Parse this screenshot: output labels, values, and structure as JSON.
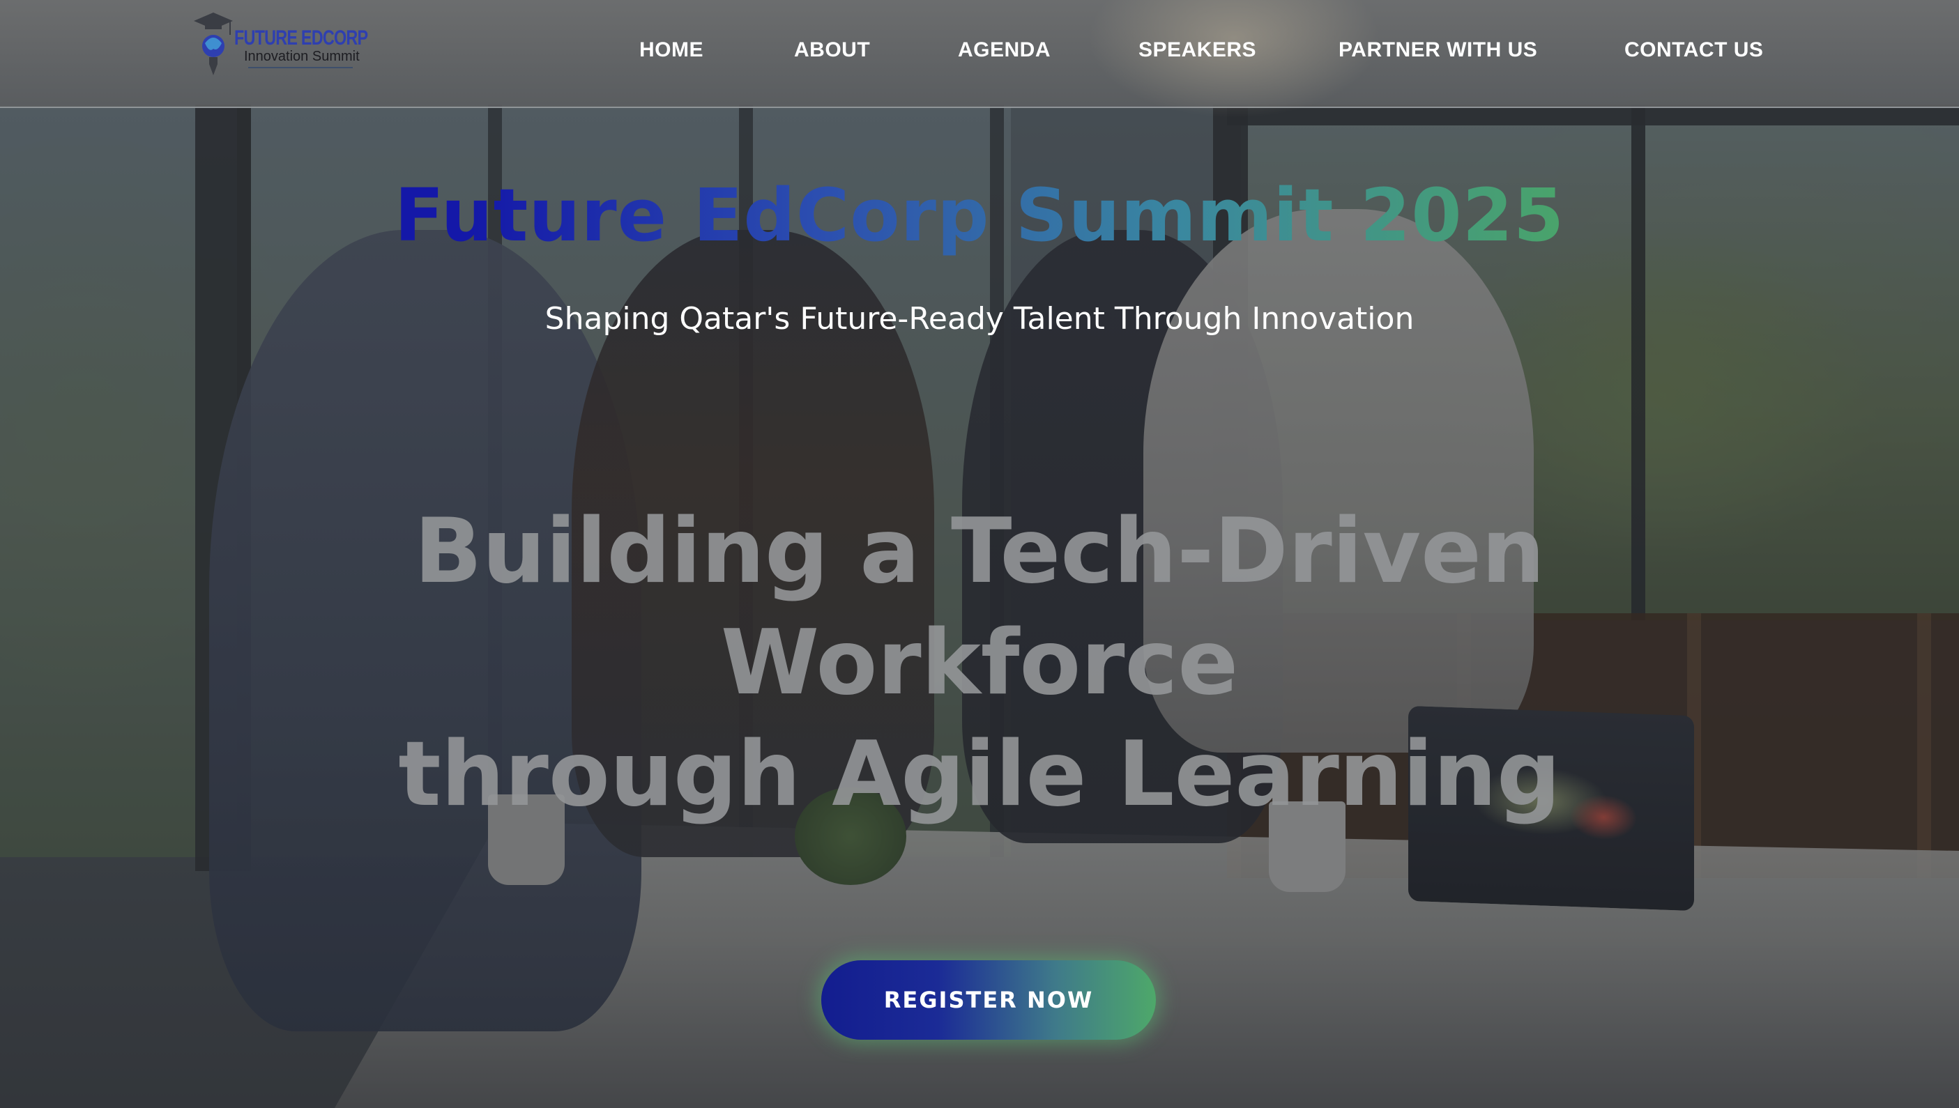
{
  "nav": {
    "logo": {
      "icon": "graduation-cap-bulb-icon",
      "brand": "FUTURE EDCORP",
      "tagline": "Innovation Summit"
    },
    "items": [
      {
        "label": "HOME"
      },
      {
        "label": "ABOUT"
      },
      {
        "label": "AGENDA"
      },
      {
        "label": "SPEAKERS"
      },
      {
        "label": "PARTNER WITH US"
      },
      {
        "label": "CONTACT US"
      }
    ]
  },
  "hero": {
    "title": "Future EdCorp Summit 2025",
    "subtitle": "Shaping Qatar's Future-Ready Talent Through Innovation",
    "headline": {
      "line1": "Building a Tech-Driven",
      "line2": "Workforce",
      "line3": "through Agile Learning"
    },
    "cta": {
      "label": "REGISTER NOW"
    },
    "background_image": "team-hands-together-office-photo"
  },
  "colors": {
    "title_gradient_start": "#1418a8",
    "title_gradient_end": "#4aa46a",
    "cta_gradient_start": "#131d8f",
    "cta_gradient_end": "#4ea86a",
    "nav_text": "#ffffff"
  }
}
